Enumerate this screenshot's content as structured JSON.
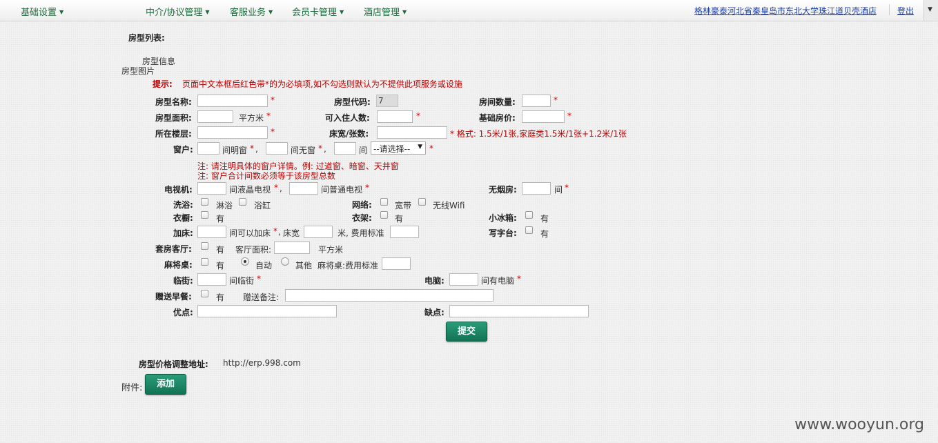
{
  "nav": {
    "menus": [
      "基础设置",
      "中介/协议管理",
      "客服业务",
      "会员卡管理",
      "酒店管理"
    ],
    "hotel_name": "格林豪泰河北省秦皇岛市东北大学珠江道贝壳酒店",
    "logout": "登出"
  },
  "page": {
    "list_title": "房型列表:",
    "tab_info": "房型信息",
    "tab_pictures": "房型图片",
    "hint_label": "提示:",
    "hint_text": "页面中文本框后红色带*的为必填项,如不勾选则默认为不提供此项服务或设施",
    "required_mark": "*"
  },
  "form": {
    "room_name_label": "房型名称:",
    "room_code_label": "房型代码:",
    "room_code_value": "7",
    "room_count_label": "房间数量:",
    "area_label": "房型面积:",
    "area_unit": "平方米",
    "capacity_label": "可入住人数:",
    "base_price_label": "基础房价:",
    "floor_label": "所在楼层:",
    "bed_label": "床宽/张数:",
    "bed_format": "* 格式: 1.5米/1张,家庭类1.5米/1张+1.2米/1张",
    "window_label": "窗户:",
    "window_bright": "间明窗",
    "window_none": "间无窗",
    "window_room": "间",
    "window_select": "--请选择--",
    "comma": ",",
    "window_note1": "注: 请注明具体的窗户详情。例: 过道窗、暗窗、天井窗",
    "window_note2": "注: 窗户合计间数必须等于该房型总数",
    "tv_label": "电视机:",
    "tv_lcd": "间液晶电视",
    "tv_normal": "间普通电视",
    "nosmoke_label": "无烟房:",
    "nosmoke_unit": "间",
    "bath_label": "洗浴:",
    "bath_shower": "淋浴",
    "bath_tub": "浴缸",
    "network_label": "网络:",
    "network_broadband": "宽带",
    "network_wifi": "无线Wifi",
    "wardrobe_label": "衣橱:",
    "has": "有",
    "hanger_label": "衣架:",
    "fridge_label": "小冰箱:",
    "extrabed_label": "加床:",
    "extrabed_text": "间可以加床",
    "extrabed_width": "床宽",
    "extrabed_fee": "米, 费用标准",
    "desk_label": "写字台:",
    "suite_label": "套房客厅:",
    "suite_area": "客厅面积:",
    "suite_unit": "平方米",
    "mahjong_label": "麻将桌:",
    "mahjong_auto": "自动",
    "mahjong_other": "其他",
    "mahjong_fee": "麻将桌:费用标准",
    "street_label": "临街:",
    "street_text": "间临街",
    "computer_label": "电脑:",
    "computer_text": "间有电脑",
    "breakfast_label": "赠送早餐:",
    "gift_note_label": "赠送备注:",
    "pros_label": "优点:",
    "cons_label": "缺点:",
    "submit": "提交"
  },
  "footer": {
    "price_url_label": "房型价格调整地址:",
    "price_url": "http://erp.998.com",
    "attachment_label": "附件:",
    "add_button": "添加"
  },
  "watermark": "www.wooyun.org"
}
